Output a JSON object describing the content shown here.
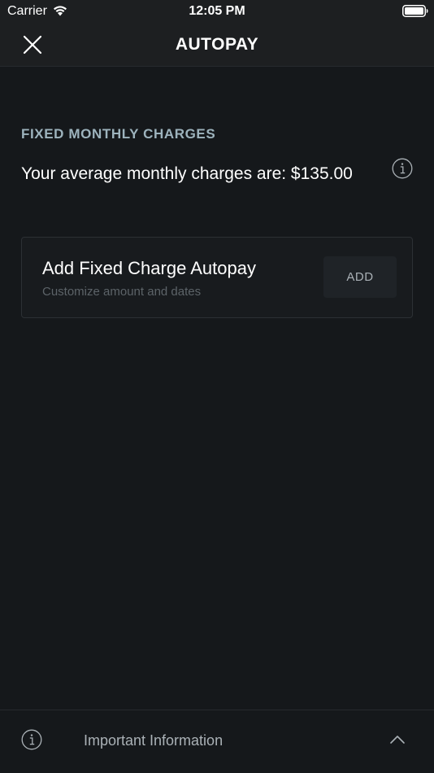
{
  "status_bar": {
    "carrier": "Carrier",
    "time": "12:05 PM",
    "icons": [
      "wifi-icon",
      "battery-icon"
    ]
  },
  "nav": {
    "title": "AUTOPAY",
    "close_icon": "close-icon"
  },
  "fixed_charges": {
    "section_title": "FIXED MONTHLY CHARGES",
    "average_text": "Your average monthly charges are: $135.00",
    "info_icon": "info-icon"
  },
  "autopay_card": {
    "title": "Add Fixed Charge Autopay",
    "subtitle": "Customize amount and dates",
    "add_label": "ADD"
  },
  "footer": {
    "label": "Important Information",
    "icons": [
      "info-icon",
      "chevron-up-icon"
    ]
  },
  "colors": {
    "background": "#15181b",
    "header": "#1d1f21",
    "section_title": "#9db3bd",
    "muted_text": "#5c6368",
    "button_bg": "#1f2327"
  }
}
